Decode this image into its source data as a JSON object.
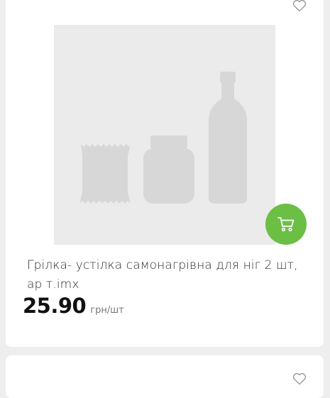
{
  "product": {
    "title": "Грілка- устілка самонагрівна для ніг 2 шт, ар т.imx",
    "price": "25.90",
    "unit": "грн/шт"
  },
  "icons": {
    "favorite": "heart-outline-icon",
    "cart": "shopping-cart-icon",
    "placeholder": "grocery-placeholder-image"
  },
  "colors": {
    "accent": "#6cbf45",
    "placeholder_bg": "#ebebeb",
    "placeholder_shapes": "#d7d7d7",
    "text": "#2b2b2b",
    "price": "#111111",
    "unit": "#777777"
  }
}
